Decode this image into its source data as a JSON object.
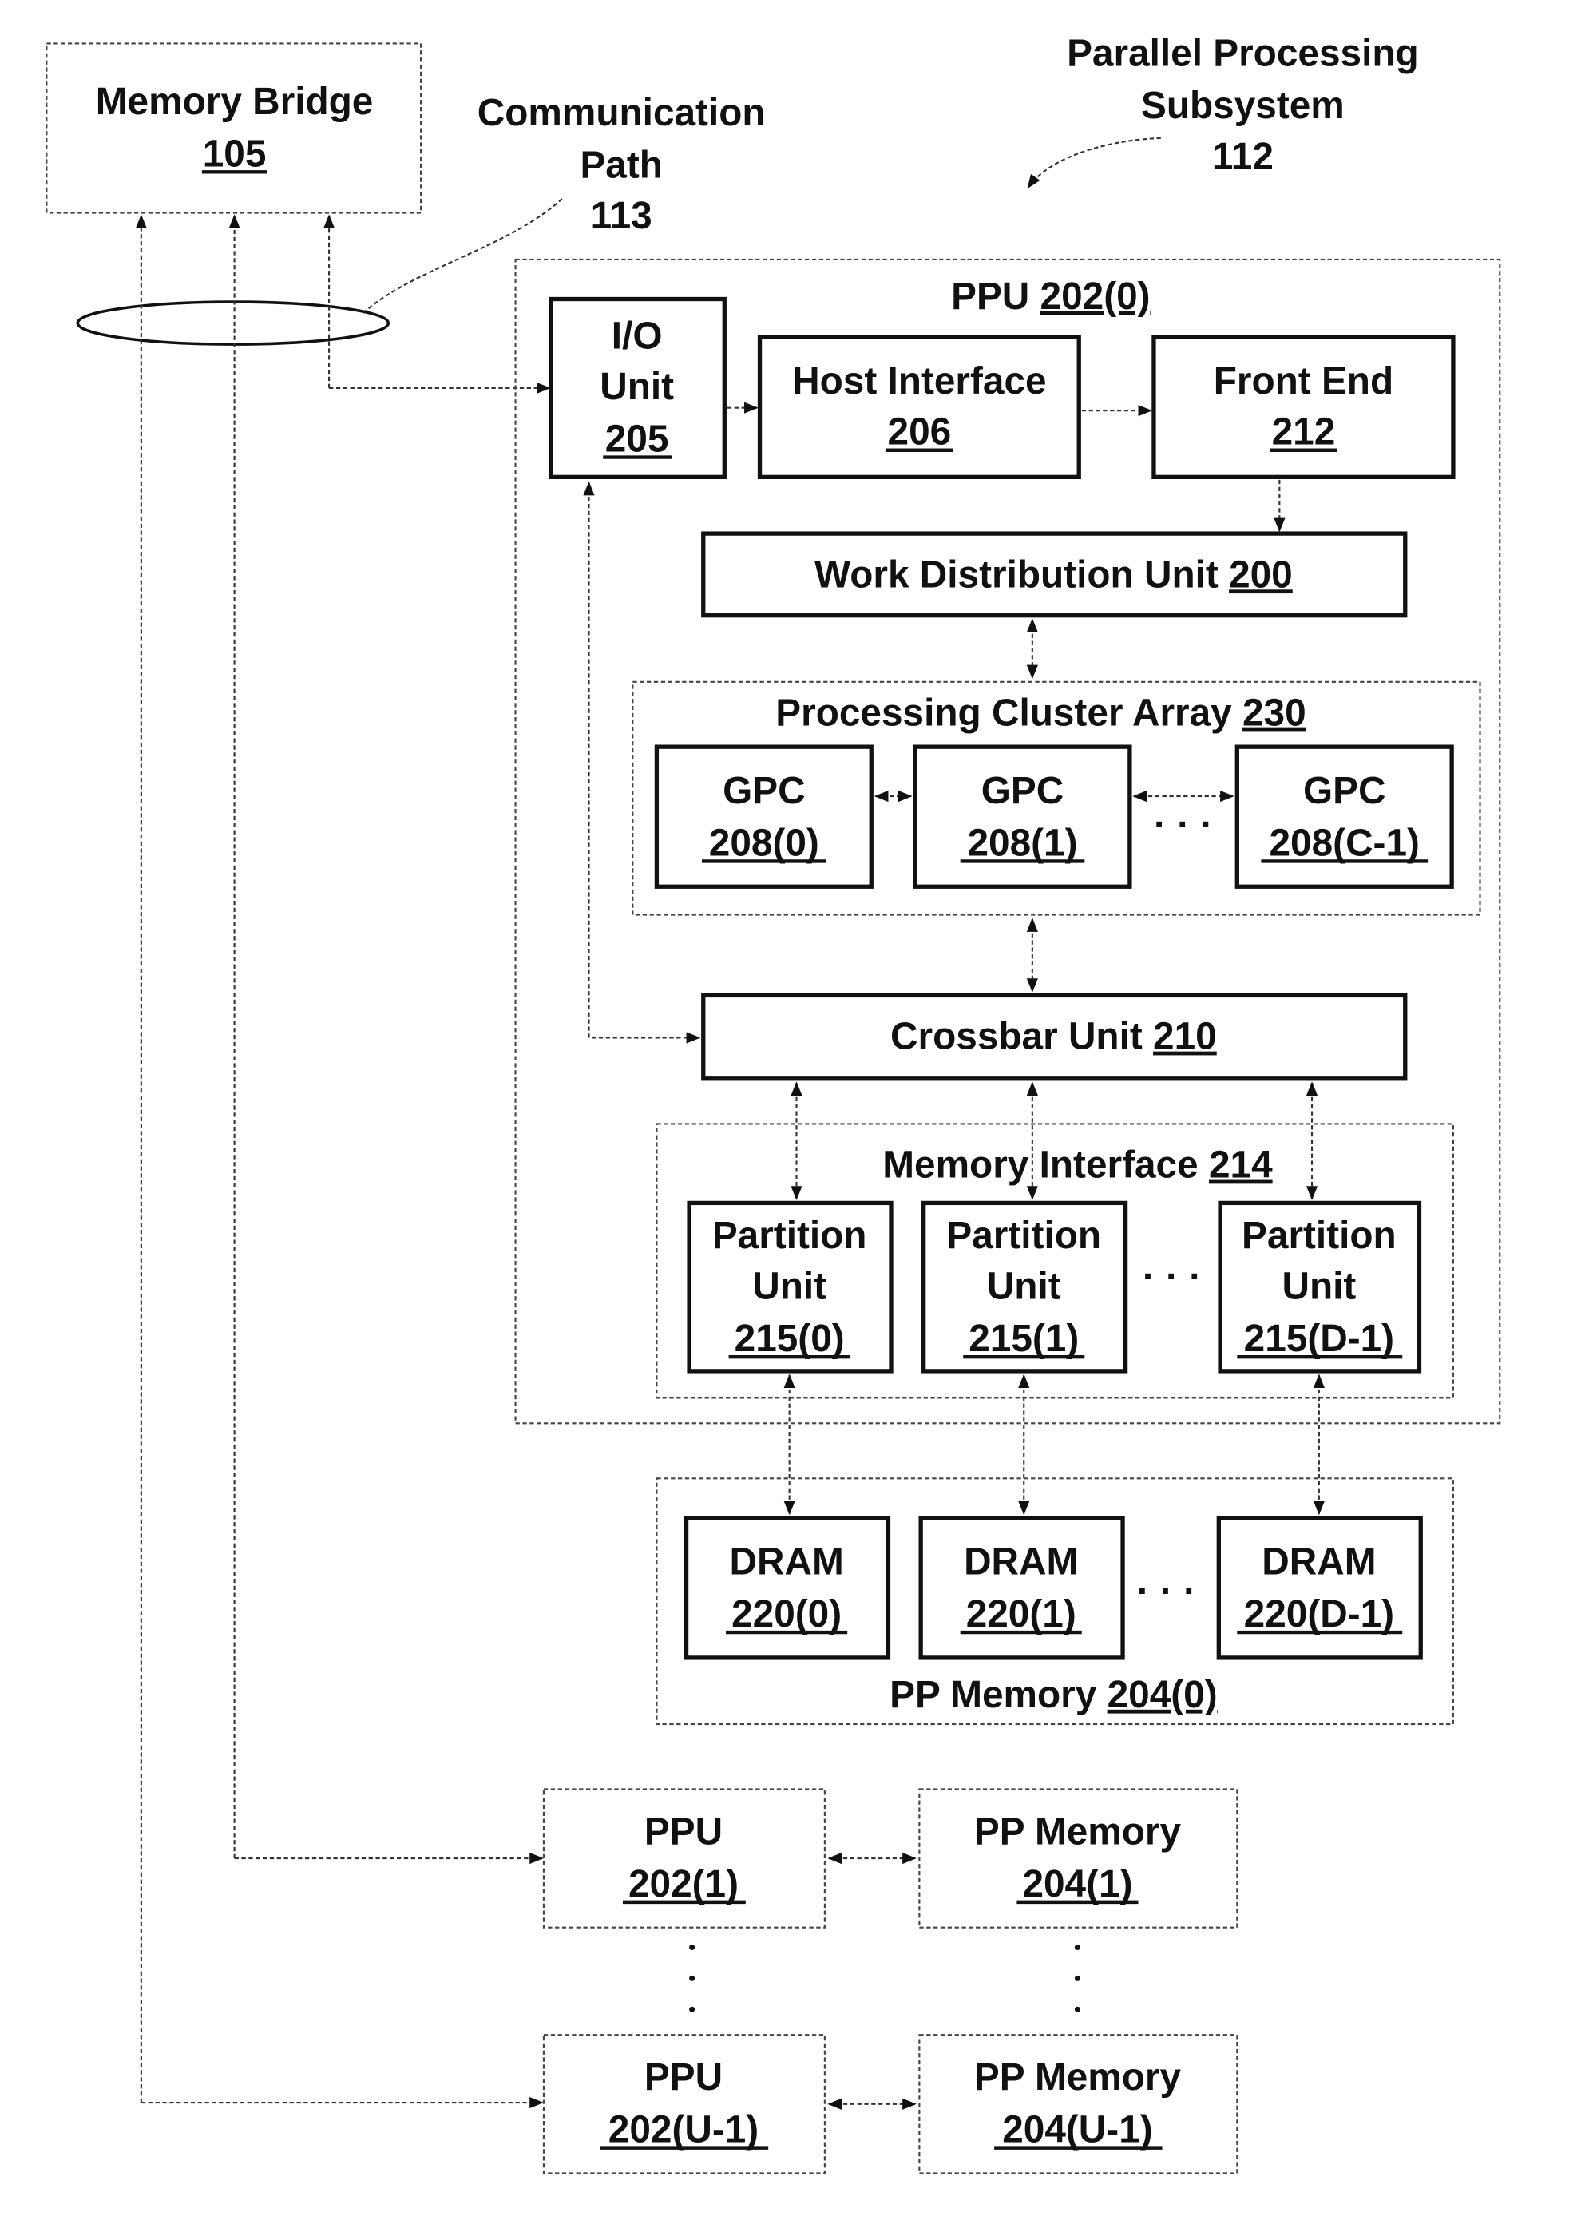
{
  "title_label": {
    "line1": "Parallel Processing",
    "line2": "Subsystem",
    "ref": "112"
  },
  "comm_path": {
    "line1": "Communication",
    "line2": "Path",
    "ref": "113"
  },
  "memory_bridge": {
    "name": "Memory Bridge",
    "ref": "105"
  },
  "ppu0": {
    "name": "PPU ",
    "ref": "202(0)"
  },
  "io_unit": {
    "line1": "I/O",
    "line2": "Unit",
    "ref": "205"
  },
  "host_interface": {
    "name": "Host Interface",
    "ref": "206"
  },
  "front_end": {
    "name": "Front End",
    "ref": "212"
  },
  "work_distribution": {
    "name": "Work Distribution Unit ",
    "ref": "200"
  },
  "pca": {
    "name": "Processing Cluster Array ",
    "ref": "230"
  },
  "gpcs": [
    {
      "name": "GPC",
      "ref": "208(0)"
    },
    {
      "name": "GPC",
      "ref": "208(1)"
    },
    {
      "name": "GPC",
      "ref": "208(C-1)"
    }
  ],
  "crossbar": {
    "name": "Crossbar Unit ",
    "ref": "210"
  },
  "memory_interface": {
    "name": "Memory Interface ",
    "ref": "214"
  },
  "partitions": [
    {
      "line1": "Partition",
      "line2": "Unit",
      "ref": "215(0)"
    },
    {
      "line1": "Partition",
      "line2": "Unit",
      "ref": "215(1)"
    },
    {
      "line1": "Partition",
      "line2": "Unit",
      "ref": "215(D-1)"
    }
  ],
  "drams": [
    {
      "name": "DRAM",
      "ref": "220(0)"
    },
    {
      "name": "DRAM",
      "ref": "220(1)"
    },
    {
      "name": "DRAM",
      "ref": "220(D-1)"
    }
  ],
  "pp_memory0": {
    "name": "PP Memory ",
    "ref": "204(0)"
  },
  "ppu1": {
    "name": "PPU",
    "ref": "202(1)"
  },
  "pp_memory1": {
    "name": "PP Memory",
    "ref": "204(1)"
  },
  "ppuU": {
    "name": "PPU",
    "ref": "202(U-1)"
  },
  "pp_memoryU": {
    "name": "PP Memory",
    "ref": "204(U-1)"
  },
  "ellipsis": "· · ·"
}
